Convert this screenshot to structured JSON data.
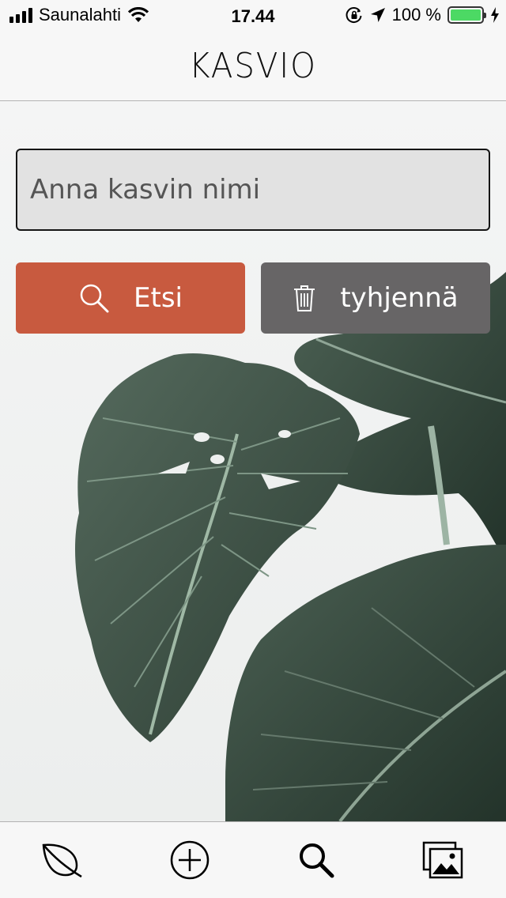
{
  "status_bar": {
    "carrier": "Saunalahti",
    "time": "17.44",
    "battery": "100 %",
    "battery_color": "#4cd964"
  },
  "header": {
    "title": "KASVIO"
  },
  "search": {
    "placeholder": "Anna kasvin nimi",
    "value": ""
  },
  "buttons": {
    "search_label": "Etsi",
    "search_icon": "search-icon",
    "search_color": "#c85a3f",
    "clear_label": "tyhjennä",
    "clear_icon": "trash-icon",
    "clear_color": "#676566"
  },
  "tab_bar": {
    "tabs": [
      {
        "icon": "leaf-icon"
      },
      {
        "icon": "add-circle-icon"
      },
      {
        "icon": "search-icon"
      },
      {
        "icon": "gallery-icon"
      }
    ]
  }
}
